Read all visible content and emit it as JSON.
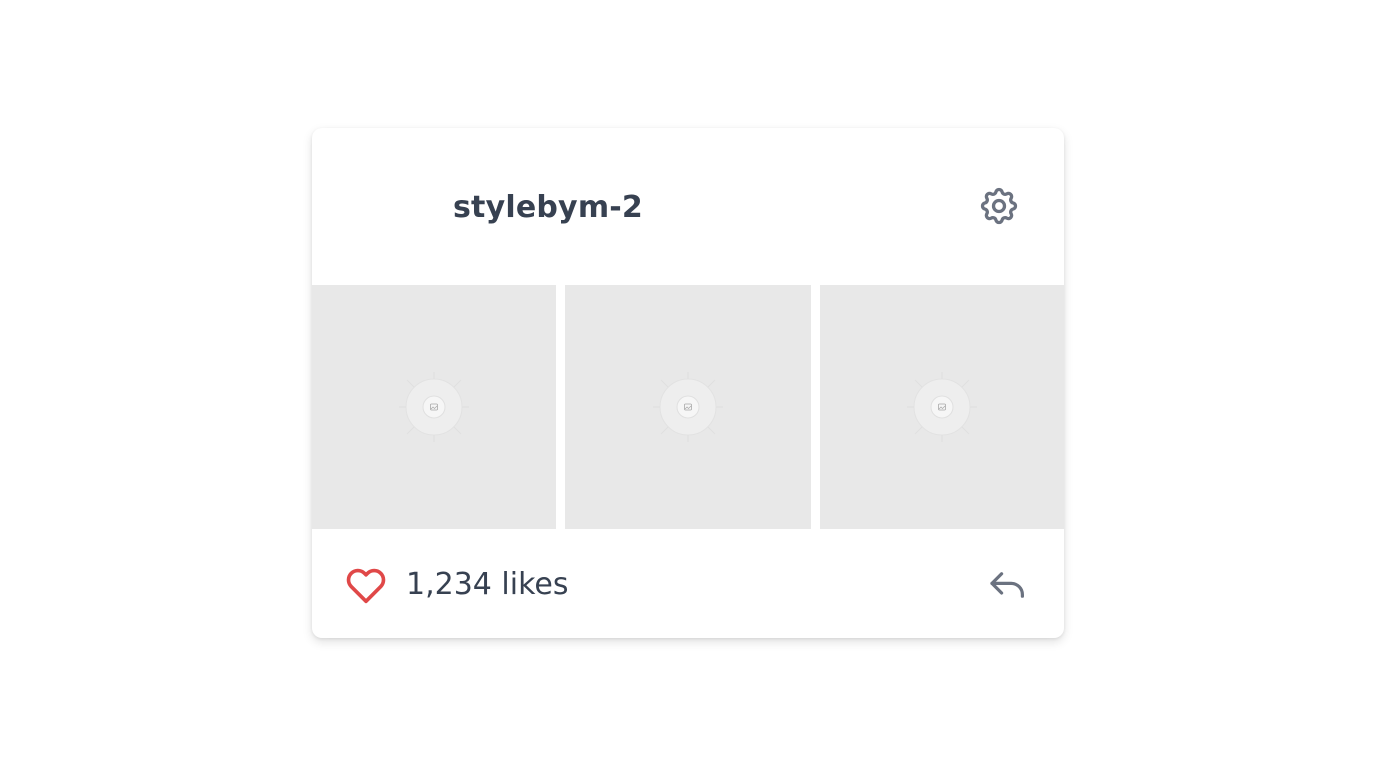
{
  "profile": {
    "username": "stylebym-2"
  },
  "header": {
    "settings_icon": "gear-icon"
  },
  "gallery": {
    "items": [
      {
        "placeholder_icon": "image-placeholder-icon"
      },
      {
        "placeholder_icon": "image-placeholder-icon"
      },
      {
        "placeholder_icon": "image-placeholder-icon"
      }
    ],
    "tile_color": "#e8e8e8"
  },
  "footer": {
    "likes_text": "1,234 likes",
    "like_icon": "heart-icon",
    "like_color": "#e04848",
    "reply_icon": "reply-icon"
  },
  "colors": {
    "text": "#374151",
    "icon": "#6b7280"
  }
}
